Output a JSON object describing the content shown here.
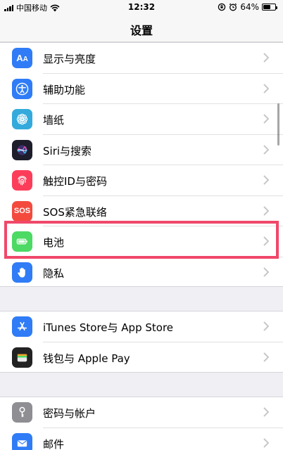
{
  "status_bar": {
    "carrier": "中国移动",
    "time": "12:32",
    "battery_percent_label": "64%",
    "battery_level": 0.64
  },
  "nav": {
    "title": "设置"
  },
  "groups": [
    {
      "items": [
        {
          "label": "显示与亮度",
          "icon": "display-brightness-icon",
          "color": "#2f7cf6"
        },
        {
          "label": "辅助功能",
          "icon": "accessibility-icon",
          "color": "#2f7cf6"
        },
        {
          "label": "墙纸",
          "icon": "wallpaper-icon",
          "color": "#34aadc"
        },
        {
          "label": "Siri与搜索",
          "icon": "siri-icon",
          "color": "#1d1d2b"
        },
        {
          "label": "触控ID与密码",
          "icon": "fingerprint-icon",
          "color": "#fc3d5a"
        },
        {
          "label": "SOS紧急联络",
          "icon": "sos-icon",
          "color": "#f44a3e",
          "icon_text": "SOS"
        },
        {
          "label": "电池",
          "icon": "battery-icon",
          "color": "#4cd964"
        },
        {
          "label": "隐私",
          "icon": "privacy-hand-icon",
          "color": "#2f7cf6"
        }
      ]
    },
    {
      "items": [
        {
          "label": "iTunes Store与 App Store",
          "icon": "app-store-icon",
          "color": "#2f7cf6"
        },
        {
          "label": "钱包与 Apple Pay",
          "icon": "wallet-icon",
          "color": "#222222"
        }
      ]
    },
    {
      "items": [
        {
          "label": "密码与帐户",
          "icon": "key-icon",
          "color": "#8e8e93"
        },
        {
          "label": "邮件",
          "icon": "mail-icon",
          "color": "#2f7cf6"
        }
      ]
    }
  ],
  "highlight": {
    "color": "#f0486a",
    "target": "电池"
  }
}
